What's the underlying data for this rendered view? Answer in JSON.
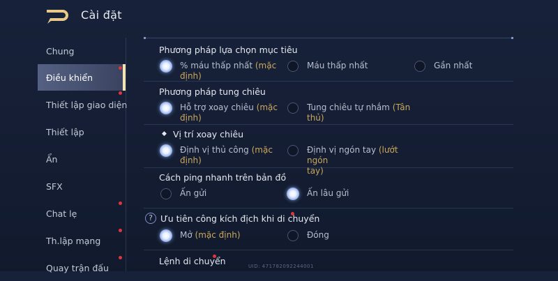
{
  "header": {
    "title": "Cài đặt"
  },
  "sidebar": {
    "items": [
      {
        "label": "Chung",
        "active": false,
        "badge": false
      },
      {
        "label": "Điều khiển",
        "active": true,
        "badge": true
      },
      {
        "label": "Thiết lập giao diện",
        "active": false,
        "badge": true
      },
      {
        "label": "Thiết lập",
        "active": false,
        "badge": false
      },
      {
        "label": "Ẩn",
        "active": false,
        "badge": false
      },
      {
        "label": "SFX",
        "active": false,
        "badge": false
      },
      {
        "label": "Chat lẹ",
        "active": false,
        "badge": true
      },
      {
        "label": "Th.lập mạng",
        "active": false,
        "badge": true
      },
      {
        "label": "Quay trận đấu",
        "active": false,
        "badge": true
      }
    ]
  },
  "sections": {
    "target": {
      "heading": "Phương pháp lựa chọn mục tiêu",
      "options": [
        {
          "line1": "% máu thấp nhất ",
          "tag1": "(mặc",
          "tag2": "định)",
          "selected": true
        },
        {
          "line1": "Máu thấp nhất",
          "selected": false
        },
        {
          "line1": "Gần nhất",
          "selected": false
        }
      ]
    },
    "cast": {
      "heading": "Phương pháp tung chiêu",
      "options": [
        {
          "line1": "Hỗ trợ xoay chiêu ",
          "tag1": "(mặc",
          "tag2": "định)",
          "selected": true
        },
        {
          "line1": "Tung chiêu tự nhắm ",
          "tag1": "(Tân",
          "tag2": "thủ)",
          "selected": false
        }
      ]
    },
    "rotate": {
      "heading": "Vị trí xoay chiêu",
      "icon": "◆",
      "options": [
        {
          "line1": "Định vị thủ công ",
          "tag1": "(mặc",
          "tag2": "định)",
          "selected": true
        },
        {
          "line1": "Định vị ngón tay ",
          "tag1": "(lướt ngón",
          "tag2": "tay)",
          "selected": false
        }
      ]
    },
    "ping": {
      "heading": "Cách ping nhanh trên bản đồ",
      "options": [
        {
          "line1": "Ấn gửi",
          "selected": false
        },
        {
          "line1": "Ấn lâu gửi",
          "selected": true
        }
      ]
    },
    "attack": {
      "heading": "Ưu tiên công kích địch khi di chuyển",
      "help": "?",
      "options": [
        {
          "line1": "Mở ",
          "tag1": "(mặc định)",
          "selected": true
        },
        {
          "line1": "Đóng",
          "selected": false
        }
      ]
    },
    "move": {
      "heading": "Lệnh di chuyển"
    }
  },
  "footer": {
    "uid": "UID: 471782092244001"
  },
  "colors": {
    "accent_gold": "#c9a85c",
    "badge_red": "#e0353c",
    "active_bar": "#f1e3b6"
  },
  "icons": {
    "back": "back-arrow-icon",
    "help": "question-icon",
    "bullet": "diamond-icon"
  }
}
